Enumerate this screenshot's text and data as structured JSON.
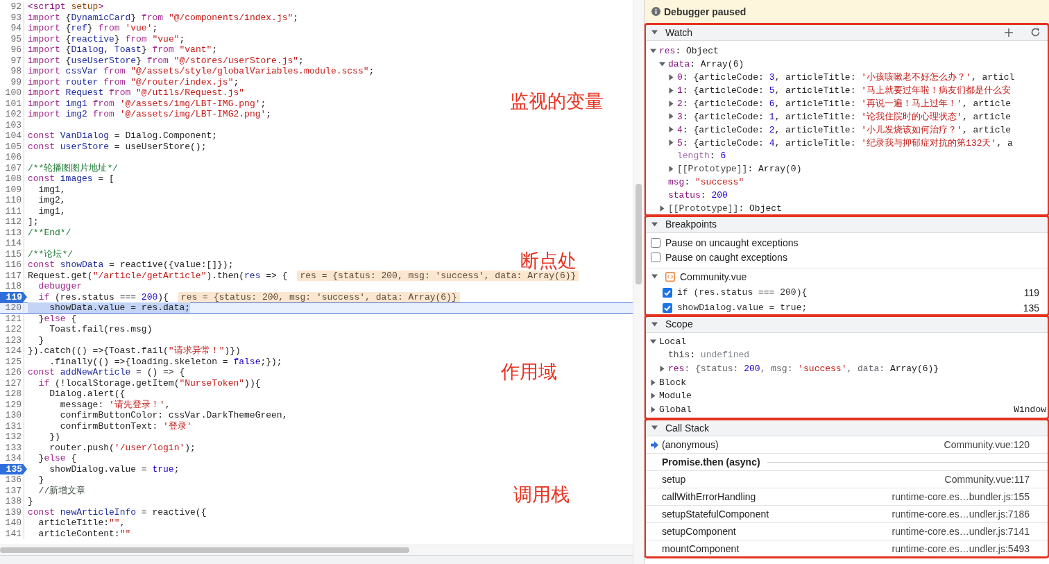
{
  "source": {
    "lines": [
      {
        "num": "92",
        "tokens": [
          {
            "kind": "tag",
            "text": "<script"
          },
          {
            "kind": "attr",
            "text": " setup"
          },
          {
            "kind": "tag",
            "text": ">"
          }
        ],
        "breakpoint": false,
        "current": false
      },
      {
        "num": "93",
        "tokens": [
          {
            "kind": "kw",
            "text": "import"
          },
          {
            "kind": "p",
            "text": " {"
          },
          {
            "kind": "v",
            "text": "DynamicCard"
          },
          {
            "kind": "p",
            "text": "} "
          },
          {
            "kind": "kw",
            "text": "from"
          },
          {
            "kind": "s",
            "text": " \"@/components/index.js\""
          },
          {
            "kind": "p",
            "text": ";"
          }
        ],
        "breakpoint": false,
        "current": false
      },
      {
        "num": "94",
        "tokens": [
          {
            "kind": "kw",
            "text": "import"
          },
          {
            "kind": "p",
            "text": " {"
          },
          {
            "kind": "v",
            "text": "ref"
          },
          {
            "kind": "p",
            "text": "} "
          },
          {
            "kind": "kw",
            "text": "from"
          },
          {
            "kind": "s",
            "text": " 'vue'"
          },
          {
            "kind": "p",
            "text": ";"
          }
        ],
        "breakpoint": false,
        "current": false
      },
      {
        "num": "95",
        "tokens": [
          {
            "kind": "kw",
            "text": "import"
          },
          {
            "kind": "p",
            "text": " {"
          },
          {
            "kind": "v",
            "text": "reactive"
          },
          {
            "kind": "p",
            "text": "} "
          },
          {
            "kind": "kw",
            "text": "from"
          },
          {
            "kind": "s",
            "text": " \"vue\""
          },
          {
            "kind": "p",
            "text": ";"
          }
        ],
        "breakpoint": false,
        "current": false
      },
      {
        "num": "96",
        "tokens": [
          {
            "kind": "kw",
            "text": "import"
          },
          {
            "kind": "p",
            "text": " {"
          },
          {
            "kind": "v",
            "text": "Dialog"
          },
          {
            "kind": "p",
            "text": ", "
          },
          {
            "kind": "v",
            "text": "Toast"
          },
          {
            "kind": "p",
            "text": "} "
          },
          {
            "kind": "kw",
            "text": "from"
          },
          {
            "kind": "s",
            "text": " \"vant\""
          },
          {
            "kind": "p",
            "text": ";"
          }
        ],
        "breakpoint": false,
        "current": false
      },
      {
        "num": "97",
        "tokens": [
          {
            "kind": "kw",
            "text": "import"
          },
          {
            "kind": "p",
            "text": " {"
          },
          {
            "kind": "v",
            "text": "useUserStore"
          },
          {
            "kind": "p",
            "text": "} "
          },
          {
            "kind": "kw",
            "text": "from"
          },
          {
            "kind": "s",
            "text": " \"@/stores/userStore.js\""
          },
          {
            "kind": "p",
            "text": ";"
          }
        ],
        "breakpoint": false,
        "current": false
      },
      {
        "num": "98",
        "tokens": [
          {
            "kind": "kw",
            "text": "import"
          },
          {
            "kind": "v",
            "text": " cssVar"
          },
          {
            "kind": "kw",
            "text": " from"
          },
          {
            "kind": "s",
            "text": " \"@/assets/style/globalVariables.module.scss\""
          },
          {
            "kind": "p",
            "text": ";"
          }
        ],
        "breakpoint": false,
        "current": false
      },
      {
        "num": "99",
        "tokens": [
          {
            "kind": "kw",
            "text": "import"
          },
          {
            "kind": "v",
            "text": " router"
          },
          {
            "kind": "kw",
            "text": " from"
          },
          {
            "kind": "s",
            "text": " \"@/router/index.js\""
          },
          {
            "kind": "p",
            "text": ";"
          }
        ],
        "breakpoint": false,
        "current": false
      },
      {
        "num": "100",
        "tokens": [
          {
            "kind": "kw",
            "text": "import"
          },
          {
            "kind": "v",
            "text": " Request"
          },
          {
            "kind": "kw",
            "text": " from"
          },
          {
            "kind": "s",
            "text": " \"@/utils/Request.js\""
          }
        ],
        "breakpoint": false,
        "current": false
      },
      {
        "num": "101",
        "tokens": [
          {
            "kind": "kw",
            "text": "import"
          },
          {
            "kind": "v",
            "text": " img1"
          },
          {
            "kind": "kw",
            "text": " from"
          },
          {
            "kind": "s",
            "text": " '@/assets/img/LBT-IMG.png'"
          },
          {
            "kind": "p",
            "text": ";"
          }
        ],
        "breakpoint": false,
        "current": false
      },
      {
        "num": "102",
        "tokens": [
          {
            "kind": "kw",
            "text": "import"
          },
          {
            "kind": "v",
            "text": " img2"
          },
          {
            "kind": "kw",
            "text": " from"
          },
          {
            "kind": "s",
            "text": " '@/assets/img/LBT-IMG2.png'"
          },
          {
            "kind": "p",
            "text": ";"
          }
        ],
        "breakpoint": false,
        "current": false
      },
      {
        "num": "103",
        "breakpoint": false,
        "current": false
      },
      {
        "num": "104",
        "tokens": [
          {
            "kind": "kw",
            "text": "const"
          },
          {
            "kind": "v",
            "text": " VanDialog"
          },
          {
            "kind": "p",
            "text": " = Dialog.Component;"
          }
        ],
        "breakpoint": false,
        "current": false
      },
      {
        "num": "105",
        "tokens": [
          {
            "kind": "kw",
            "text": "const"
          },
          {
            "kind": "v",
            "text": " userStore"
          },
          {
            "kind": "p",
            "text": " = useUserStore();"
          }
        ],
        "breakpoint": false,
        "current": false
      },
      {
        "num": "106",
        "breakpoint": false,
        "current": false
      },
      {
        "num": "107",
        "tokens": [
          {
            "kind": "c",
            "text": "/**轮播图图片地址*/"
          }
        ],
        "breakpoint": false,
        "current": false
      },
      {
        "num": "108",
        "tokens": [
          {
            "kind": "kw",
            "text": "const"
          },
          {
            "kind": "v",
            "text": " images"
          },
          {
            "kind": "p",
            "text": " = ["
          }
        ],
        "breakpoint": false,
        "current": false
      },
      {
        "num": "109",
        "tokens": [
          {
            "kind": "p",
            "text": "  img1,"
          }
        ],
        "breakpoint": false,
        "current": false
      },
      {
        "num": "110",
        "tokens": [
          {
            "kind": "p",
            "text": "  img2,"
          }
        ],
        "breakpoint": false,
        "current": false
      },
      {
        "num": "111",
        "tokens": [
          {
            "kind": "p",
            "text": "  img1,"
          }
        ],
        "breakpoint": false,
        "current": false
      },
      {
        "num": "112",
        "tokens": [
          {
            "kind": "p",
            "text": "];"
          }
        ],
        "breakpoint": false,
        "current": false
      },
      {
        "num": "113",
        "tokens": [
          {
            "kind": "c",
            "text": "/**End*/"
          }
        ],
        "breakpoint": false,
        "current": false
      },
      {
        "num": "114",
        "breakpoint": false,
        "current": false
      },
      {
        "num": "115",
        "tokens": [
          {
            "kind": "c",
            "text": "/**论坛*/"
          }
        ],
        "breakpoint": false,
        "current": false
      },
      {
        "num": "116",
        "tokens": [
          {
            "kind": "kw",
            "text": "const"
          },
          {
            "kind": "v",
            "text": " showData"
          },
          {
            "kind": "p",
            "text": " = reactive({value:[]});"
          }
        ],
        "breakpoint": false,
        "current": false
      },
      {
        "num": "117",
        "tokens": [
          {
            "kind": "p",
            "text": "Request.get("
          },
          {
            "kind": "s",
            "text": "\"/article/getArticle\""
          },
          {
            "kind": "p",
            "text": ").then("
          },
          {
            "kind": "v",
            "text": "res"
          },
          {
            "kind": "p",
            "text": " => {"
          }
        ],
        "breakpoint": false,
        "current": false,
        "inline": "res = {status: 200, msg: 'success', data: Array(6)}"
      },
      {
        "num": "118",
        "tokens": [
          {
            "kind": "kw",
            "text": "  debugger"
          }
        ],
        "breakpoint": false,
        "current": false
      },
      {
        "num": "119",
        "tokens": [
          {
            "kind": "kw",
            "text": "  if"
          },
          {
            "kind": "p",
            "text": " (res.status === "
          },
          {
            "kind": "n",
            "text": "200"
          },
          {
            "kind": "p",
            "text": "){"
          }
        ],
        "breakpoint": true,
        "current": false,
        "inline": "res = {status: 200, msg: 'success', data: Array(6)}"
      },
      {
        "num": "120",
        "tokens": [
          {
            "kind": "p",
            "text": "    showData.value = res.data;"
          }
        ],
        "breakpoint": false,
        "current": true
      },
      {
        "num": "121",
        "tokens": [
          {
            "kind": "p",
            "text": "  }"
          },
          {
            "kind": "kw",
            "text": "else"
          },
          {
            "kind": "p",
            "text": " {"
          }
        ],
        "breakpoint": false,
        "current": false
      },
      {
        "num": "122",
        "tokens": [
          {
            "kind": "p",
            "text": "    Toast.fail(res.msg)"
          }
        ],
        "breakpoint": false,
        "current": false
      },
      {
        "num": "123",
        "tokens": [
          {
            "kind": "p",
            "text": "  }"
          }
        ],
        "breakpoint": false,
        "current": false
      },
      {
        "num": "124",
        "tokens": [
          {
            "kind": "p",
            "text": "}).catch(() =>{Toast.fail("
          },
          {
            "kind": "s",
            "text": "\"请求异常！\""
          },
          {
            "kind": "p",
            "text": ")})"
          }
        ],
        "breakpoint": false,
        "current": false
      },
      {
        "num": "125",
        "tokens": [
          {
            "kind": "p",
            "text": "    .finally(() =>{loading.skeleton = "
          },
          {
            "kind": "n",
            "text": "false"
          },
          {
            "kind": "p",
            "text": ";});"
          }
        ],
        "breakpoint": false,
        "current": false
      },
      {
        "num": "126",
        "tokens": [
          {
            "kind": "kw",
            "text": "const"
          },
          {
            "kind": "v",
            "text": " addNewArticle"
          },
          {
            "kind": "p",
            "text": " = () => {"
          }
        ],
        "breakpoint": false,
        "current": false
      },
      {
        "num": "127",
        "tokens": [
          {
            "kind": "kw",
            "text": "  if"
          },
          {
            "kind": "p",
            "text": " (!localStorage.getItem("
          },
          {
            "kind": "s",
            "text": "\"NurseToken\""
          },
          {
            "kind": "p",
            "text": ")){"
          }
        ],
        "breakpoint": false,
        "current": false
      },
      {
        "num": "128",
        "tokens": [
          {
            "kind": "p",
            "text": "    Dialog.alert({"
          }
        ],
        "breakpoint": false,
        "current": false
      },
      {
        "num": "129",
        "tokens": [
          {
            "kind": "p",
            "text": "      message: "
          },
          {
            "kind": "s",
            "text": "'请先登录！'"
          },
          {
            "kind": "p",
            "text": ","
          }
        ],
        "breakpoint": false,
        "current": false
      },
      {
        "num": "130",
        "tokens": [
          {
            "kind": "p",
            "text": "      confirmButtonColor: cssVar.DarkThemeGreen,"
          }
        ],
        "breakpoint": false,
        "current": false
      },
      {
        "num": "131",
        "tokens": [
          {
            "kind": "p",
            "text": "      confirmButtonText: "
          },
          {
            "kind": "s",
            "text": "'登录'"
          }
        ],
        "breakpoint": false,
        "current": false
      },
      {
        "num": "132",
        "tokens": [
          {
            "kind": "p",
            "text": "    })"
          }
        ],
        "breakpoint": false,
        "current": false
      },
      {
        "num": "133",
        "tokens": [
          {
            "kind": "p",
            "text": "    router.push("
          },
          {
            "kind": "s",
            "text": "'/user/login'"
          },
          {
            "kind": "p",
            "text": ");"
          }
        ],
        "breakpoint": false,
        "current": false
      },
      {
        "num": "134",
        "tokens": [
          {
            "kind": "p",
            "text": "  }"
          },
          {
            "kind": "kw",
            "text": "else"
          },
          {
            "kind": "p",
            "text": " {"
          }
        ],
        "breakpoint": false,
        "current": false
      },
      {
        "num": "135",
        "tokens": [
          {
            "kind": "p",
            "text": "    showDialog.value = "
          },
          {
            "kind": "n",
            "text": "true"
          },
          {
            "kind": "p",
            "text": ";"
          }
        ],
        "breakpoint": true,
        "current": false
      },
      {
        "num": "136",
        "tokens": [
          {
            "kind": "p",
            "text": "  }"
          }
        ],
        "breakpoint": false,
        "current": false
      },
      {
        "num": "137",
        "tokens": [
          {
            "kind": "cg",
            "text": "  //新增文章"
          }
        ],
        "breakpoint": false,
        "current": false
      },
      {
        "num": "138",
        "tokens": [
          {
            "kind": "p",
            "text": "}"
          }
        ],
        "breakpoint": false,
        "current": false
      },
      {
        "num": "139",
        "tokens": [
          {
            "kind": "kw",
            "text": "const"
          },
          {
            "kind": "v",
            "text": " newArticleInfo"
          },
          {
            "kind": "p",
            "text": " = reactive({"
          }
        ],
        "breakpoint": false,
        "current": false
      },
      {
        "num": "140",
        "tokens": [
          {
            "kind": "p",
            "text": "  articleTitle:"
          },
          {
            "kind": "s",
            "text": "\"\""
          },
          {
            "kind": "p",
            "text": ","
          }
        ],
        "breakpoint": false,
        "current": false
      },
      {
        "num": "141",
        "tokens": [
          {
            "kind": "p",
            "text": "  articleContent:"
          },
          {
            "kind": "s",
            "text": "\"\""
          }
        ],
        "breakpoint": false,
        "current": false
      }
    ]
  },
  "annotations": [
    {
      "text": "监视的变量"
    },
    {
      "text": "断点处"
    },
    {
      "text": "作用域"
    },
    {
      "text": "调用栈"
    }
  ],
  "paused_banner": {
    "text": "Debugger paused"
  },
  "watch": {
    "title": "Watch",
    "expanded": true,
    "annotated": true,
    "items": [
      {
        "name": "res",
        "kind": "prop",
        "expanded": true,
        "value": [
          {
            "kind": "p",
            "text": ": Object"
          }
        ],
        "children": [
          {
            "name": "data",
            "kind": "prop",
            "expanded": true,
            "value": [
              {
                "kind": "p",
                "text": ": Array(6)"
              }
            ],
            "children": [
              {
                "name": "0",
                "kind": "prop",
                "expanded": false,
                "value": [
                  {
                    "kind": "p",
                    "text": ": {articleCode: "
                  },
                  {
                    "kind": "n",
                    "text": "3"
                  },
                  {
                    "kind": "p",
                    "text": ", articleTitle: "
                  },
                  {
                    "kind": "s",
                    "text": "'小孩咳嗽老不好怎么办？'"
                  },
                  {
                    "kind": "p",
                    "text": ", articl"
                  }
                ]
              },
              {
                "name": "1",
                "kind": "prop",
                "expanded": false,
                "value": [
                  {
                    "kind": "p",
                    "text": ": {articleCode: "
                  },
                  {
                    "kind": "n",
                    "text": "5"
                  },
                  {
                    "kind": "p",
                    "text": ", articleTitle: "
                  },
                  {
                    "kind": "s",
                    "text": "'马上就要过年啦！病友们都是什么安"
                  }
                ]
              },
              {
                "name": "2",
                "kind": "prop",
                "expanded": false,
                "value": [
                  {
                    "kind": "p",
                    "text": ": {articleCode: "
                  },
                  {
                    "kind": "n",
                    "text": "6"
                  },
                  {
                    "kind": "p",
                    "text": ", articleTitle: "
                  },
                  {
                    "kind": "s",
                    "text": "'再说一遍！马上过年！'"
                  },
                  {
                    "kind": "p",
                    "text": ", article"
                  }
                ]
              },
              {
                "name": "3",
                "kind": "prop",
                "expanded": false,
                "value": [
                  {
                    "kind": "p",
                    "text": ": {articleCode: "
                  },
                  {
                    "kind": "n",
                    "text": "1"
                  },
                  {
                    "kind": "p",
                    "text": ", articleTitle: "
                  },
                  {
                    "kind": "s",
                    "text": "'论我住院时的心理状态'"
                  },
                  {
                    "kind": "p",
                    "text": ", article"
                  }
                ]
              },
              {
                "name": "4",
                "kind": "prop",
                "expanded": false,
                "value": [
                  {
                    "kind": "p",
                    "text": ": {articleCode: "
                  },
                  {
                    "kind": "n",
                    "text": "2"
                  },
                  {
                    "kind": "p",
                    "text": ", articleTitle: "
                  },
                  {
                    "kind": "s",
                    "text": "'小儿发烧该如何治疗？'"
                  },
                  {
                    "kind": "p",
                    "text": ", article"
                  }
                ]
              },
              {
                "name": "5",
                "kind": "prop",
                "expanded": false,
                "value": [
                  {
                    "kind": "p",
                    "text": ": {articleCode: "
                  },
                  {
                    "kind": "n",
                    "text": "4"
                  },
                  {
                    "kind": "p",
                    "text": ", articleTitle: "
                  },
                  {
                    "kind": "s",
                    "text": "'纪录我与抑郁症对抗的第132天'"
                  },
                  {
                    "kind": "p",
                    "text": ", a"
                  }
                ]
              },
              {
                "name": "length",
                "kind": "internal",
                "value": [
                  {
                    "kind": "p",
                    "text": ": "
                  },
                  {
                    "kind": "n",
                    "text": "6"
                  }
                ]
              },
              {
                "name": "[[Prototype]]",
                "kind": "meta",
                "expanded": false,
                "value": [
                  {
                    "kind": "p",
                    "text": ": Array(0)"
                  }
                ]
              }
            ]
          },
          {
            "name": "msg",
            "kind": "prop",
            "value": [
              {
                "kind": "p",
                "text": ": "
              },
              {
                "kind": "s",
                "text": "\"success\""
              }
            ]
          },
          {
            "name": "status",
            "kind": "prop",
            "value": [
              {
                "kind": "p",
                "text": ": "
              },
              {
                "kind": "n",
                "text": "200"
              }
            ]
          },
          {
            "name": "[[Prototype]]",
            "kind": "meta",
            "expanded": false,
            "value": [
              {
                "kind": "p",
                "text": ": Object"
              }
            ]
          }
        ]
      }
    ]
  },
  "breakpoints": {
    "title": "Breakpoints",
    "expanded": true,
    "annotated": true,
    "options": [
      {
        "label": "Pause on uncaught exceptions",
        "checked": false
      },
      {
        "label": "Pause on caught exceptions",
        "checked": false
      }
    ],
    "files": [
      {
        "name": "Community.vue",
        "expanded": true,
        "items": [
          {
            "code": "if (res.status === 200){",
            "line": "119",
            "checked": true
          },
          {
            "code": "showDialog.value = true;",
            "line": "135",
            "checked": true
          }
        ]
      }
    ]
  },
  "scope": {
    "title": "Scope",
    "expanded": true,
    "annotated": true,
    "items": [
      {
        "name": "Local",
        "kind": "group",
        "expanded": true,
        "children": [
          {
            "name": "this",
            "kind": "meta",
            "value": [
              {
                "kind": "p",
                "text": ": "
              },
              {
                "kind": "u",
                "text": "undefined"
              }
            ]
          },
          {
            "name": "res",
            "kind": "prop",
            "expanded": false,
            "value": [
              {
                "kind": "k",
                "text": ": {status: "
              },
              {
                "kind": "n",
                "text": "200"
              },
              {
                "kind": "k",
                "text": ", msg: "
              },
              {
                "kind": "s",
                "text": "'success'"
              },
              {
                "kind": "k",
                "text": ", data: "
              },
              {
                "kind": "p",
                "text": "Array(6)}"
              }
            ]
          }
        ]
      },
      {
        "name": "Block",
        "kind": "group",
        "expanded": false
      },
      {
        "name": "Module",
        "kind": "group",
        "expanded": false
      },
      {
        "name": "Global",
        "kind": "group",
        "expanded": false,
        "value": [
          {
            "kind": "p",
            "text": "Window"
          }
        ]
      }
    ]
  },
  "call_stack": {
    "title": "Call Stack",
    "expanded": true,
    "annotated": true,
    "frames": [
      {
        "kind": "frame",
        "name": "(anonymous)",
        "location": "Community.vue:120",
        "selected": true
      },
      {
        "kind": "async",
        "name": "Promise.then (async)",
        "selected": false
      },
      {
        "kind": "frame",
        "name": "setup",
        "location": "Community.vue:117",
        "selected": false
      },
      {
        "kind": "frame",
        "name": "callWithErrorHandling",
        "location": "runtime-core.es…bundler.js:155",
        "selected": false
      },
      {
        "kind": "frame",
        "name": "setupStatefulComponent",
        "location": "runtime-core.es…undler.js:7186",
        "selected": false
      },
      {
        "kind": "frame",
        "name": "setupComponent",
        "location": "runtime-core.es…undler.js:7141",
        "selected": false
      },
      {
        "kind": "frame",
        "name": "mountComponent",
        "location": "runtime-core.es…undler.js:5493",
        "selected": false
      }
    ]
  }
}
